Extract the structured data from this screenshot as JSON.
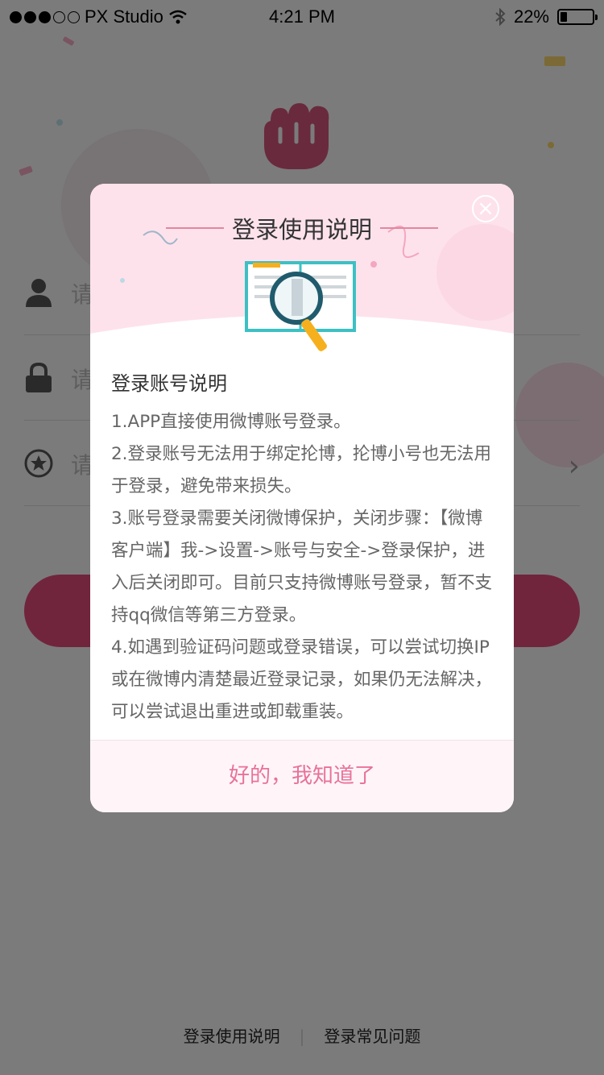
{
  "status_bar": {
    "carrier": "PX Studio",
    "time": "4:21 PM",
    "battery": "22%",
    "battery_level": 0.22,
    "signal_dots_filled": 3,
    "signal_dots_total": 5
  },
  "login": {
    "username_placeholder": "请",
    "password_placeholder": "请",
    "invite_placeholder": "请",
    "accent_color": "#e04a7a"
  },
  "bottom_links": {
    "guide": "登录使用说明",
    "faq": "登录常见问题"
  },
  "dialog": {
    "title": "登录使用说明",
    "section_title": "登录账号说明",
    "paragraphs": [
      "1.APP直接使用微博账号登录。",
      "2.登录账号无法用于绑定抡博，抡博小号也无法用于登录，避免带来损失。",
      "3.账号登录需要关闭微博保护，关闭步骤：【微博客户端】我->设置->账号与安全->登录保护，进入后关闭即可。目前只支持微博账号登录，暂不支持qq微信等第三方登录。",
      "4.如遇到验证码问题或登录错误，可以尝试切换IP或在微博内清楚最近登录记录，如果仍无法解决，可以尝试退出重进或卸载重装。"
    ],
    "confirm_label": "好的，我知道了",
    "confirm_color": "#e8729a"
  }
}
